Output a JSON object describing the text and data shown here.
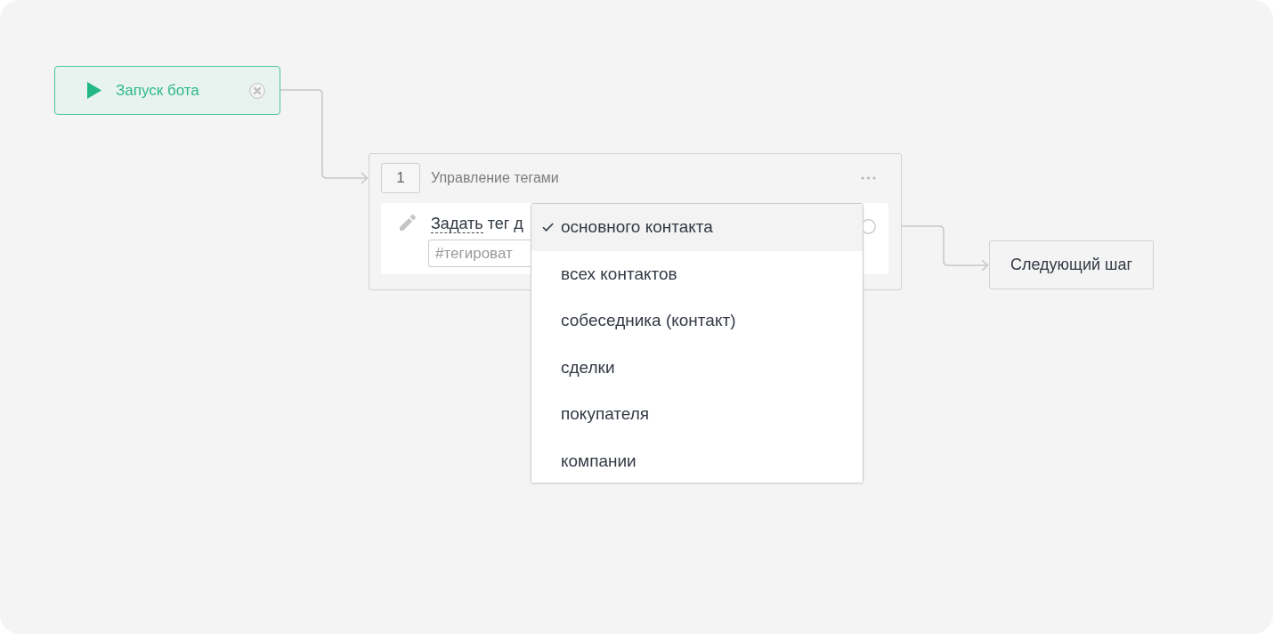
{
  "start_node": {
    "label": "Запуск бота"
  },
  "step": {
    "number": "1",
    "title": "Управление тегами",
    "action": {
      "link": "Задать",
      "text": "тег д"
    },
    "tag_field": {
      "placeholder": "#тегироват"
    }
  },
  "dropdown": {
    "options": [
      {
        "label": "основного контакта",
        "selected": true
      },
      {
        "label": "всех контактов",
        "selected": false
      },
      {
        "label": "собеседника (контакт)",
        "selected": false
      },
      {
        "label": "сделки",
        "selected": false
      },
      {
        "label": "покупателя",
        "selected": false
      },
      {
        "label": "компании",
        "selected": false
      }
    ]
  },
  "next_node": {
    "label": "Следующий шаг"
  }
}
